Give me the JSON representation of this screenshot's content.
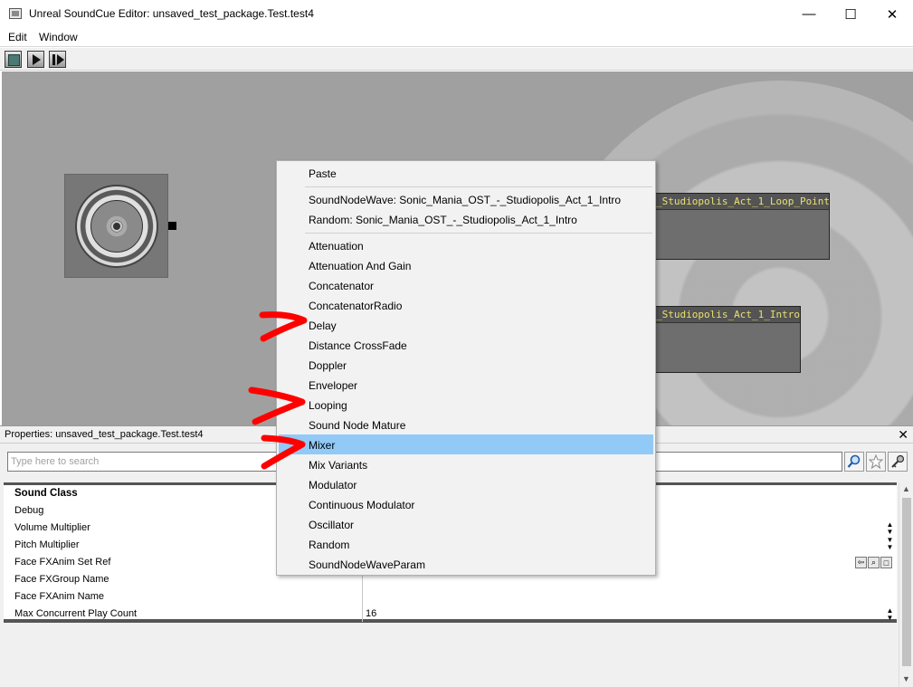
{
  "window": {
    "title": "Unreal SoundCue Editor: unsaved_test_package.Test.test4",
    "minimize": "—",
    "maximize": "☐",
    "close": "✕"
  },
  "menubar": {
    "items": [
      "Edit",
      "Window"
    ]
  },
  "toolbar": {
    "buttons": [
      "stop-icon",
      "play-icon",
      "play-all-icon"
    ]
  },
  "canvas": {
    "nodes": [
      {
        "title": "_Studiopolis_Act_1_Loop_Point"
      },
      {
        "title": "_Studiopolis_Act_1_Intro"
      }
    ]
  },
  "context_menu": {
    "items": [
      "Paste",
      "SoundNodeWave: Sonic_Mania_OST_-_Studiopolis_Act_1_Intro",
      "Random: Sonic_Mania_OST_-_Studiopolis_Act_1_Intro",
      "Attenuation",
      "Attenuation And Gain",
      "Concatenator",
      "ConcatenatorRadio",
      "Delay",
      "Distance CrossFade",
      "Doppler",
      "Enveloper",
      "Looping",
      "Sound Node Mature",
      "Mixer",
      "Mix Variants",
      "Modulator",
      "Continuous Modulator",
      "Oscillator",
      "Random",
      "SoundNodeWaveParam"
    ],
    "highlighted": "Mixer",
    "highlight_color": "#91c9f7"
  },
  "properties": {
    "title": "Properties: unsaved_test_package.Test.test4",
    "close": "✕",
    "search_placeholder": "Type here to search",
    "rows": [
      {
        "label": "Sound Class",
        "value": ""
      },
      {
        "label": "Debug",
        "value": ""
      },
      {
        "label": "Volume Multiplier",
        "value": ""
      },
      {
        "label": "Pitch Multiplier",
        "value": ""
      },
      {
        "label": "Face FXAnim Set Ref",
        "value": ""
      },
      {
        "label": "Face FXGroup Name",
        "value": ""
      },
      {
        "label": "Face FXAnim Name",
        "value": ""
      },
      {
        "label": "Max Concurrent Play Count",
        "value": "16"
      }
    ]
  },
  "annotation_color": "#ff0000"
}
